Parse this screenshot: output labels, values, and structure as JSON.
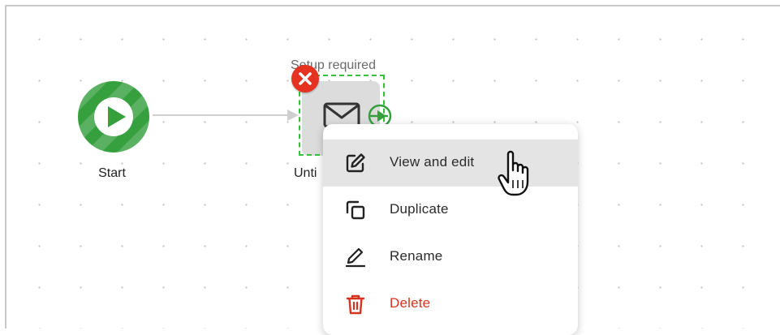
{
  "canvas": {
    "start_label": "Start",
    "node": {
      "status": "Setup required",
      "label": "Unti"
    }
  },
  "context_menu": {
    "items": [
      {
        "label": "View and edit",
        "icon": "edit-icon",
        "state": "hover"
      },
      {
        "label": "Duplicate",
        "icon": "duplicate-icon"
      },
      {
        "label": "Rename",
        "icon": "rename-icon"
      },
      {
        "label": "Delete",
        "icon": "trash-icon",
        "color": "#d6331f"
      }
    ]
  },
  "colors": {
    "start_green": "#36a03f",
    "selection_green": "#35c13f",
    "error_red": "#e53221",
    "hover_bg": "#e4e4e4"
  }
}
